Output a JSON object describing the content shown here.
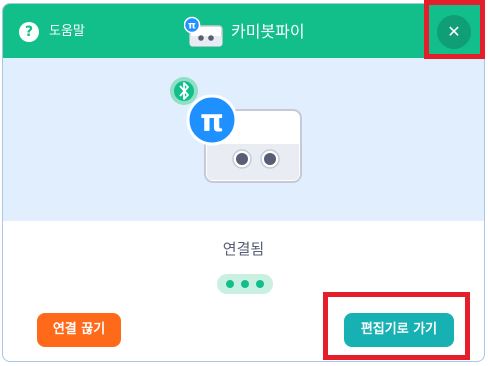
{
  "header": {
    "help_label": "도움말",
    "help_icon_glyph": "?",
    "title": "카미봇파이",
    "close_glyph": "✕",
    "bg_color": "#12bf8b"
  },
  "main": {
    "status_text": "연결됨"
  },
  "icons": {
    "bluetooth_icon": "bluetooth-icon",
    "pi_icon": "pi-icon",
    "robot_icon": "robot-icon"
  },
  "buttons": {
    "disconnect_label": "연결 끊기",
    "go_to_editor_label": "편집기로 가기"
  },
  "colors": {
    "accent_green": "#12bf8b",
    "disconnect_orange": "#ff6a1a",
    "go_teal": "#17b0b3",
    "highlight_red": "#e51e2b",
    "hero_bg": "#e1eefe"
  }
}
